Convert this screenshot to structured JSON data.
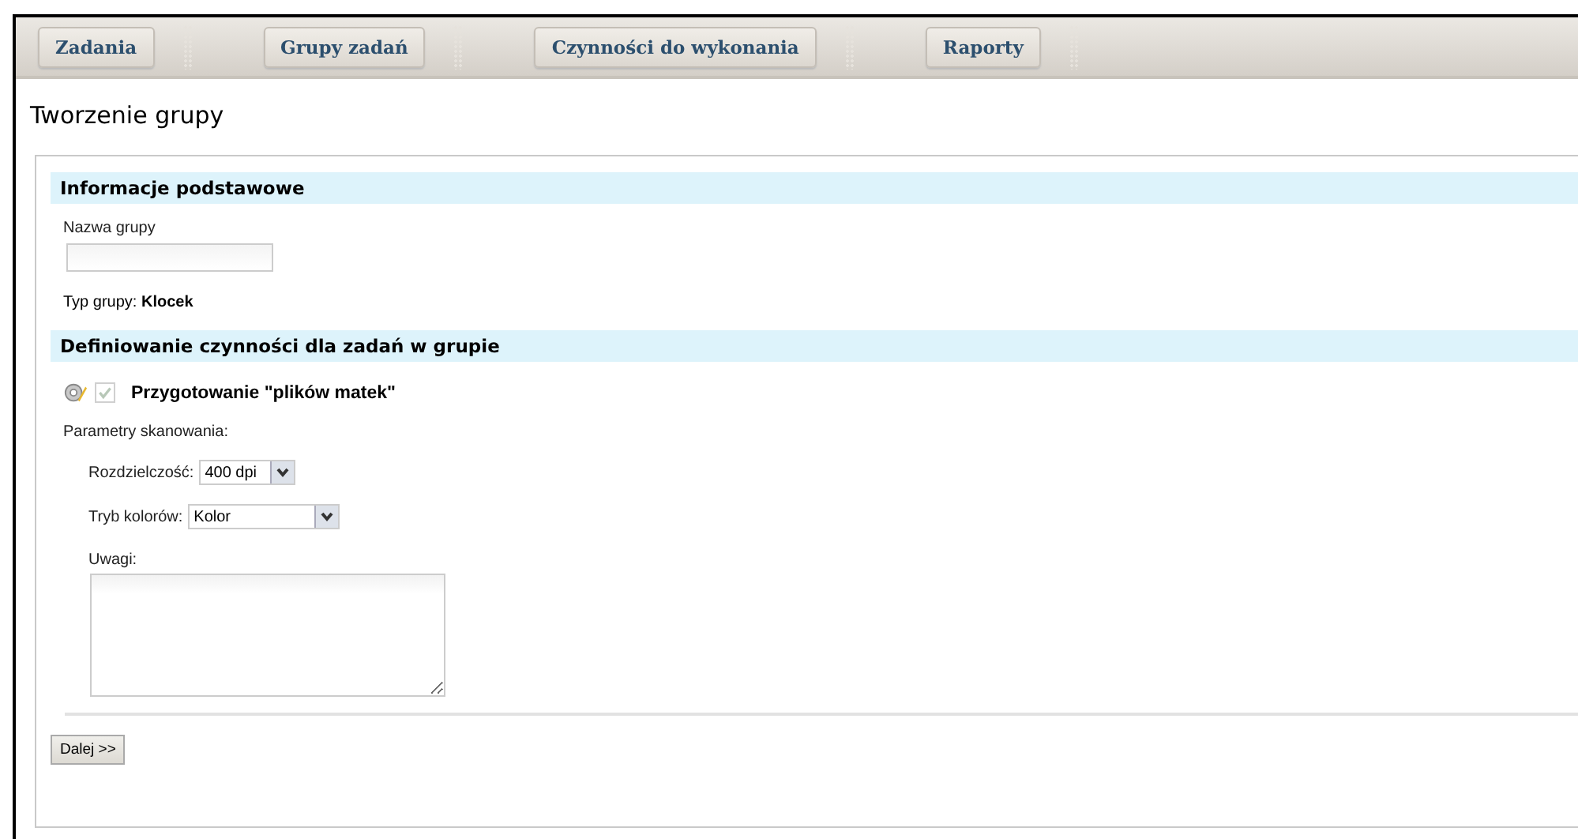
{
  "nav": [
    {
      "label": "Zadania"
    },
    {
      "label": "Grupy zadań"
    },
    {
      "label": "Czynności do wykonania"
    },
    {
      "label": "Raporty"
    }
  ],
  "page_title": "Tworzenie grupy",
  "basic_section": {
    "heading": "Informacje podstawowe",
    "name_label": "Nazwa grupy",
    "type_text": "Typ grupy: **Klocek**"
  },
  "tasks_section": {
    "heading": "Definiowanie czynności dla zadań w grupie",
    "task": {
      "label": "Przygotowanie \"plików matek\"",
      "checked": true,
      "disabled": true
    },
    "params_label": "Parametry skanowania:",
    "resolution": {
      "label": "Rozdzielczość:",
      "value": "400 dpi"
    },
    "color_mode": {
      "label": "Tryb kolorów:",
      "value": "Kolor"
    },
    "notes": {
      "label": "Uwagi:"
    }
  },
  "next_button": "Dalej >>"
}
